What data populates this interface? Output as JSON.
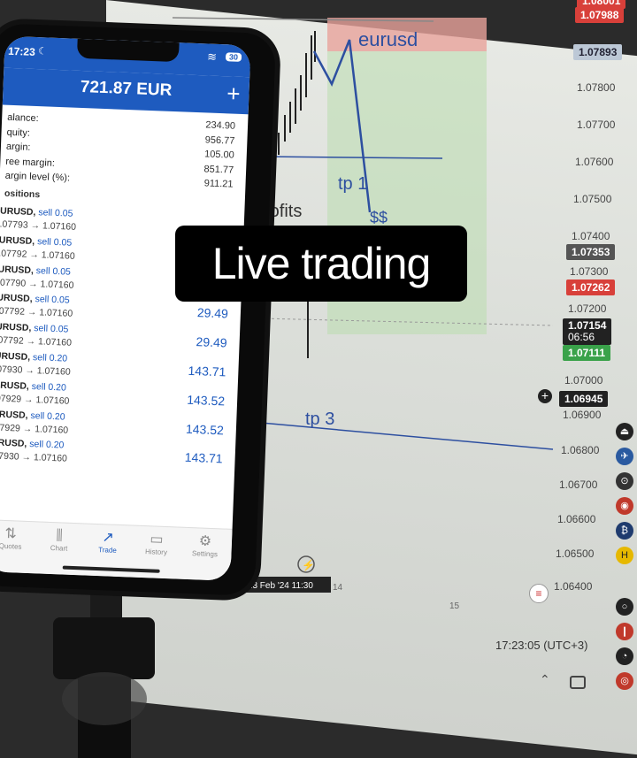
{
  "overlay": {
    "title": "Live trading"
  },
  "phone": {
    "status": {
      "time": "17:23",
      "battery": "30"
    },
    "header": {
      "title": "721.87 EUR",
      "plus": "+"
    },
    "account": {
      "rows": [
        {
          "label": "alance:",
          "value": "234.90"
        },
        {
          "label": "quity:",
          "value": "956.77"
        },
        {
          "label": "argin:",
          "value": "105.00"
        },
        {
          "label": "ree margin:",
          "value": "851.77"
        },
        {
          "label": "argin level (%):",
          "value": "911.21"
        }
      ]
    },
    "positions_label": "ositions",
    "positions": [
      {
        "symbol": "URUSD,",
        "type": "sell 0.05",
        "prices": ".07793 → 1.07160",
        "profit": ""
      },
      {
        "symbol": "URUSD,",
        "type": "sell 0.05",
        "prices": ".07792 → 1.07160",
        "profit": ""
      },
      {
        "symbol": "URUSD,",
        "type": "sell 0.05",
        "prices": ".07790 → 1.07160",
        "profit": ""
      },
      {
        "symbol": "URUSD,",
        "type": "sell 0.05",
        "prices": ".07792 → 1.07160",
        "profit": "29.49"
      },
      {
        "symbol": "URUSD,",
        "type": "sell 0.05",
        "prices": ".07792 → 1.07160",
        "profit": "29.49"
      },
      {
        "symbol": "URUSD,",
        "type": "sell 0.20",
        "prices": ".07930 → 1.07160",
        "profit": "143.71"
      },
      {
        "symbol": "URUSD,",
        "type": "sell 0.20",
        "prices": ".07929 → 1.07160",
        "profit": "143.52"
      },
      {
        "symbol": "URUSD,",
        "type": "sell 0.20",
        "prices": ".07929 → 1.07160",
        "profit": "143.52"
      },
      {
        "symbol": "URUSD,",
        "type": "sell 0.20",
        "prices": ".07930 → 1.07160",
        "profit": "143.71"
      }
    ],
    "tabs": [
      {
        "label": "Quotes",
        "icon": "quotes-icon",
        "glyph": "⇅"
      },
      {
        "label": "Chart",
        "icon": "chart-icon",
        "glyph": "⫼"
      },
      {
        "label": "Trade",
        "icon": "trade-icon",
        "glyph": "↗"
      },
      {
        "label": "History",
        "icon": "history-icon",
        "glyph": "▭"
      },
      {
        "label": "Settings",
        "icon": "settings-icon",
        "glyph": "⚙"
      }
    ]
  },
  "chart": {
    "annotations": {
      "symbol": "eurusd",
      "tp1": "tp 1",
      "tp3": "tp 3",
      "profits": "rofits",
      "money": "$$"
    },
    "time_label": "ue 13 Feb '24  11:30",
    "x_tick_14": "14",
    "x_tick_15": "15",
    "clock": "17:23:05 (UTC+3)",
    "price_ticks": [
      "1.07800",
      "1.07700",
      "1.07600",
      "1.07500",
      "1.07400",
      "1.07300",
      "1.07200",
      "1.07000",
      "1.06900",
      "1.06800",
      "1.06700",
      "1.06600",
      "1.06500",
      "1.06400"
    ],
    "price_boxes": {
      "top_red": "1.07988",
      "top_blue": "1.07893",
      "gray": "1.07353",
      "red": "1.07262",
      "current": "1.07154",
      "countdown": "06:56",
      "green": "1.07111",
      "cursor": "1.06945",
      "partial_top": "1.08001"
    },
    "colors": {
      "sell_zone": "#e8a39b",
      "tp_zone": "#b9dcae",
      "tp_line": "#2d4fa0",
      "box_red": "#d8403a",
      "box_green": "#3aa24a",
      "box_dark": "#222222"
    }
  }
}
